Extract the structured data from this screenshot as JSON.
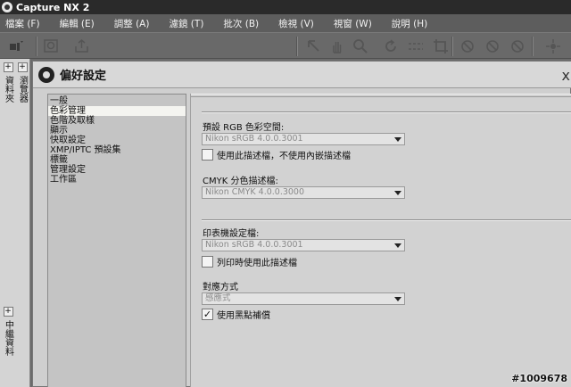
{
  "app": {
    "title": "Capture NX 2"
  },
  "menu": [
    {
      "label": "檔案 (F)"
    },
    {
      "label": "編輯 (E)"
    },
    {
      "label": "調整 (A)"
    },
    {
      "label": "濾鏡 (T)"
    },
    {
      "label": "批次 (B)"
    },
    {
      "label": "檢視 (V)"
    },
    {
      "label": "視窗 (W)"
    },
    {
      "label": "說明 (H)"
    }
  ],
  "toolbar_icons": [
    "layout-icon",
    "zoom-tool-icon",
    "export-icon",
    "select-arrow-icon",
    "hand-icon",
    "zoom-icon",
    "rotate-icon",
    "straighten-icon",
    "crop-icon",
    "red-eye-icon",
    "color-point-icon",
    "control-point-icon",
    "selection-brush-icon"
  ],
  "left_strip": {
    "toggle": "+",
    "col1": "資料夾",
    "col2": "瀏覽器",
    "col3": "中繼資料"
  },
  "dialog": {
    "title": "偏好設定",
    "close": "x",
    "nav_items": [
      "一般",
      "色彩管理",
      "色階及取樣",
      "顯示",
      "快取設定",
      "XMP/IPTC 預設集",
      "標籤",
      "管理設定",
      "工作區"
    ],
    "selected_index": 1
  },
  "panel": {
    "default_rgb_label": "預設 RGB 色彩空間:",
    "default_rgb_value": "Nikon sRGB 4.0.0.3001",
    "use_profile_label": "使用此描述檔，不使用內嵌描述檔",
    "use_profile_checked": false,
    "cmyk_label": "CMYK 分色描述檔:",
    "cmyk_value": "Nikon CMYK 4.0.0.3000",
    "printer_label": "印表機設定檔:",
    "printer_value": "Nikon sRGB 4.0.0.3001",
    "print_use_label": "列印時使用此描述檔",
    "print_use_checked": false,
    "intent_label": "對應方式",
    "intent_value": "感應式",
    "bpc_label": "使用黑點補償",
    "bpc_checked": true,
    "check_mark": "✓"
  },
  "watermark": "#1009678"
}
